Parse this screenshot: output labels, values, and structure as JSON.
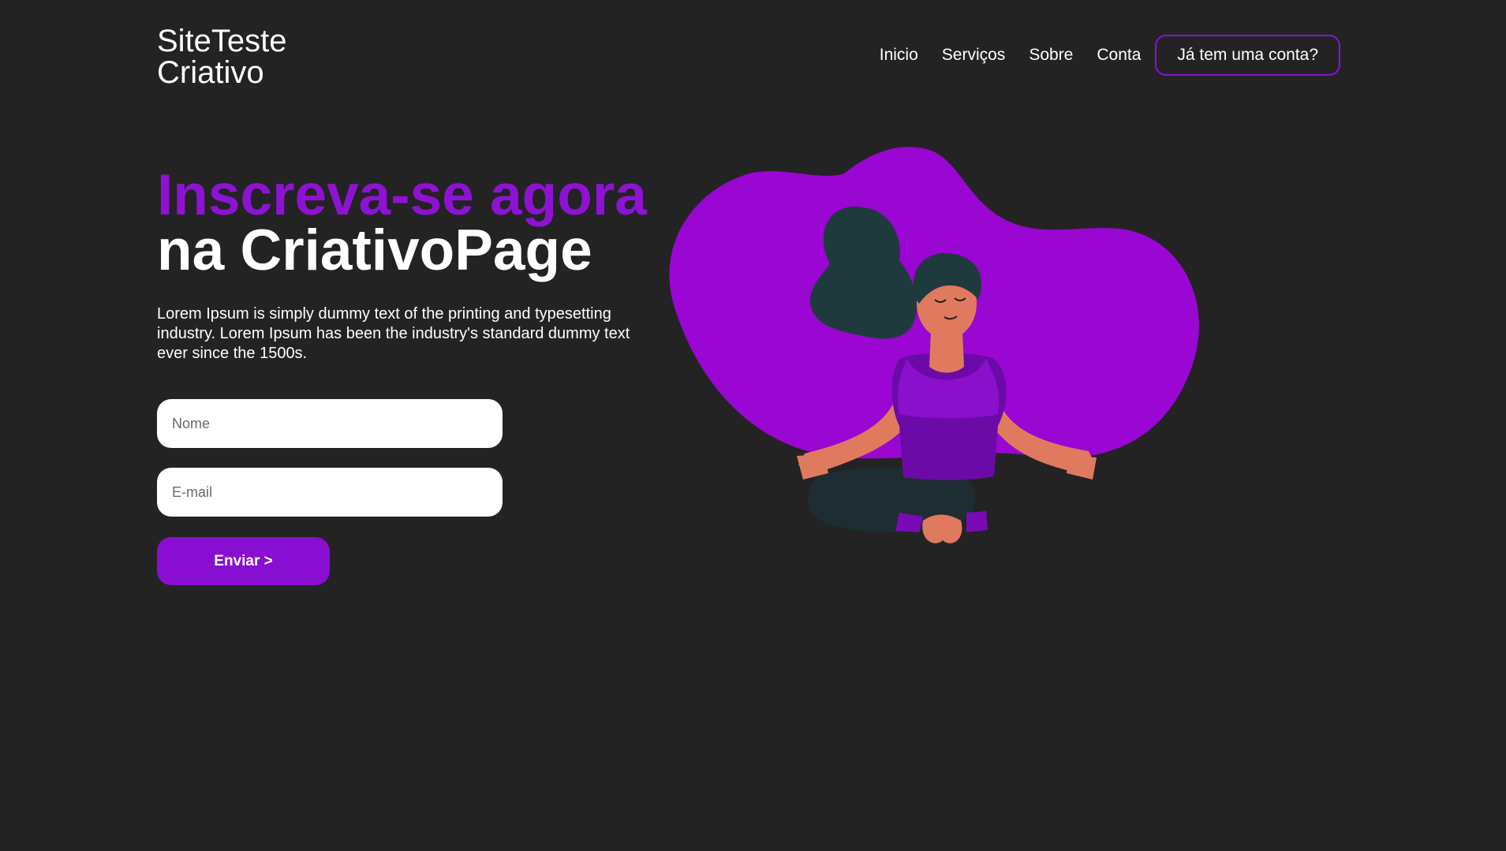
{
  "header": {
    "logo_line1": "SiteTeste",
    "logo_line2": "Criativo",
    "nav": {
      "home": "Inicio",
      "services": "Serviços",
      "about": "Sobre",
      "account": "Conta",
      "login_button": "Já tem uma conta?"
    }
  },
  "hero": {
    "headline_accent": "Inscreva-se agora",
    "headline_main": "na CriativoPage",
    "description": "Lorem Ipsum is simply dummy text of the printing and typesetting industry. Lorem Ipsum has been the industry's standard dummy text ever since the 1500s."
  },
  "form": {
    "name_placeholder": "Nome",
    "email_placeholder": "E-mail",
    "submit_label": "Enviar >"
  },
  "colors": {
    "background": "#232323",
    "accent": "#8e12d4",
    "blob": "#9a06d2",
    "button": "#880fd2"
  },
  "illustration": {
    "icon": "meditating-woman-illustration"
  }
}
